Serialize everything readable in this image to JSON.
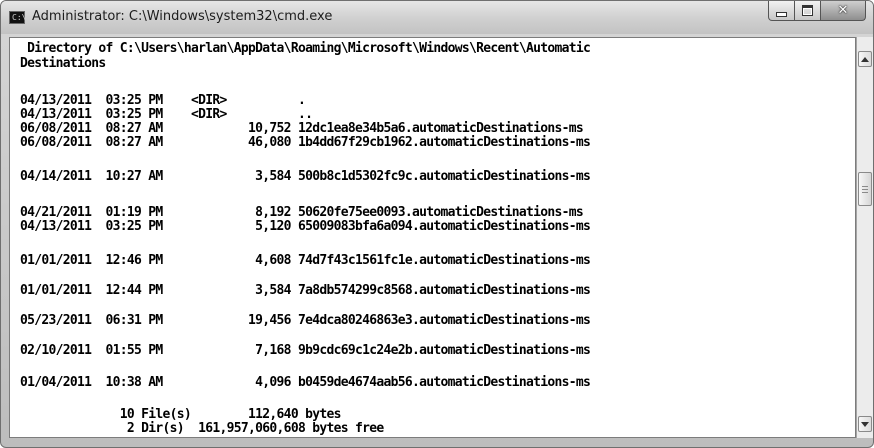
{
  "window": {
    "title": "Administrator: C:\\Windows\\system32\\cmd.exe",
    "icon_label": "C:\\"
  },
  "console": {
    "lines": [
      " Directory of C:\\Users\\harlan\\AppData\\Roaming\\Microsoft\\Windows\\Recent\\Automatic",
      "Destinations",
      "04/13/2011  03:25 PM    <DIR>          .",
      "04/13/2011  03:25 PM    <DIR>          ..",
      "06/08/2011  08:27 AM            10,752 12dc1ea8e34b5a6.automaticDestinations-ms",
      "06/08/2011  08:27 AM            46,080 1b4dd67f29cb1962.automaticDestinations-ms",
      "04/14/2011  10:27 AM             3,584 500b8c1d5302fc9c.automaticDestinations-ms",
      "04/21/2011  01:19 PM             8,192 50620fe75ee0093.automaticDestinations-ms",
      "04/13/2011  03:25 PM             5,120 65009083bfa6a094.automaticDestinations-ms",
      "01/01/2011  12:46 PM             4,608 74d7f43c1561fc1e.automaticDestinations-ms",
      "01/01/2011  12:44 PM             3,584 7a8db574299c8568.automaticDestinations-ms",
      "05/23/2011  06:31 PM            19,456 7e4dca80246863e3.automaticDestinations-ms",
      "02/10/2011  01:55 PM             7,168 9b9cdc69c1c24e2b.automaticDestinations-ms",
      "01/04/2011  10:38 AM             4,096 b0459de4674aab56.automaticDestinations-ms",
      "              10 File(s)        112,640 bytes",
      "               2 Dir(s)  161,957,060,608 bytes free"
    ]
  },
  "icons": {
    "minimize": "minimize-icon",
    "maximize": "maximize-icon",
    "close": "close-icon",
    "scroll_up": "scroll-up-arrow-icon",
    "scroll_down": "scroll-down-arrow-icon"
  },
  "colors": {
    "console_bg": "#ffffff",
    "console_text": "#000000",
    "frame": "#c8c8c8"
  }
}
